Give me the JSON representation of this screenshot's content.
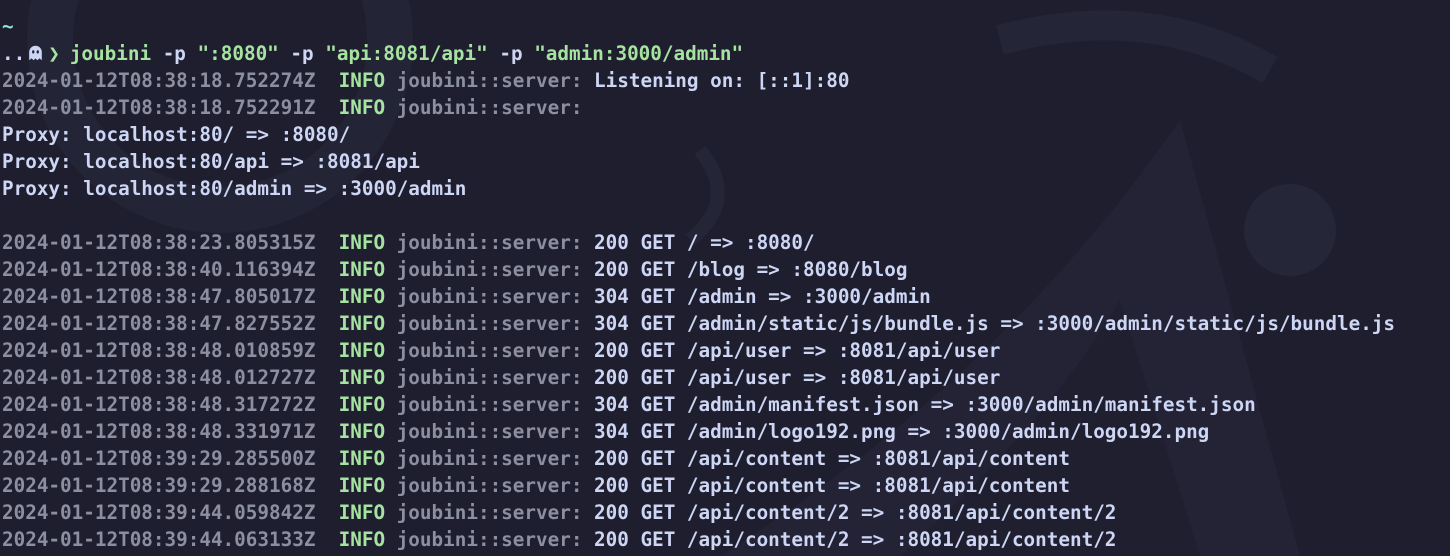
{
  "colors": {
    "background": "#1e1e2e",
    "foreground": "#cdd6f4",
    "green": "#a6e3a1",
    "teal": "#94e2d5",
    "dim": "#8c8fa1"
  },
  "prompt": {
    "cwd": "~",
    "dots": "..",
    "ghost_icon": "ghost-icon",
    "arrow": "❯",
    "command": "joubini",
    "args": [
      {
        "flag": "-p",
        "value": "\":8080\""
      },
      {
        "flag": "-p",
        "value": "\"api:8081/api\""
      },
      {
        "flag": "-p",
        "value": "\"admin:3000/admin\""
      }
    ]
  },
  "startup": [
    {
      "ts": "2024-01-12T08:38:18.752274Z",
      "level": "INFO",
      "target": "joubini::server:",
      "msg": "Listening on: [::1]:80"
    },
    {
      "ts": "2024-01-12T08:38:18.752291Z",
      "level": "INFO",
      "target": "joubini::server:",
      "msg": ""
    }
  ],
  "proxies": [
    "Proxy: localhost:80/ => :8080/",
    "Proxy: localhost:80/api => :8081/api",
    "Proxy: localhost:80/admin => :3000/admin"
  ],
  "requests": [
    {
      "ts": "2024-01-12T08:38:23.805315Z",
      "level": "INFO",
      "target": "joubini::server:",
      "msg": "200 GET / => :8080/"
    },
    {
      "ts": "2024-01-12T08:38:40.116394Z",
      "level": "INFO",
      "target": "joubini::server:",
      "msg": "200 GET /blog => :8080/blog"
    },
    {
      "ts": "2024-01-12T08:38:47.805017Z",
      "level": "INFO",
      "target": "joubini::server:",
      "msg": "304 GET /admin => :3000/admin"
    },
    {
      "ts": "2024-01-12T08:38:47.827552Z",
      "level": "INFO",
      "target": "joubini::server:",
      "msg": "304 GET /admin/static/js/bundle.js => :3000/admin/static/js/bundle.js"
    },
    {
      "ts": "2024-01-12T08:38:48.010859Z",
      "level": "INFO",
      "target": "joubini::server:",
      "msg": "200 GET /api/user => :8081/api/user"
    },
    {
      "ts": "2024-01-12T08:38:48.012727Z",
      "level": "INFO",
      "target": "joubini::server:",
      "msg": "200 GET /api/user => :8081/api/user"
    },
    {
      "ts": "2024-01-12T08:38:48.317272Z",
      "level": "INFO",
      "target": "joubini::server:",
      "msg": "304 GET /admin/manifest.json => :3000/admin/manifest.json"
    },
    {
      "ts": "2024-01-12T08:38:48.331971Z",
      "level": "INFO",
      "target": "joubini::server:",
      "msg": "304 GET /admin/logo192.png => :3000/admin/logo192.png"
    },
    {
      "ts": "2024-01-12T08:39:29.285500Z",
      "level": "INFO",
      "target": "joubini::server:",
      "msg": "200 GET /api/content => :8081/api/content"
    },
    {
      "ts": "2024-01-12T08:39:29.288168Z",
      "level": "INFO",
      "target": "joubini::server:",
      "msg": "200 GET /api/content => :8081/api/content"
    },
    {
      "ts": "2024-01-12T08:39:44.059842Z",
      "level": "INFO",
      "target": "joubini::server:",
      "msg": "200 GET /api/content/2 => :8081/api/content/2"
    },
    {
      "ts": "2024-01-12T08:39:44.063133Z",
      "level": "INFO",
      "target": "joubini::server:",
      "msg": "200 GET /api/content/2 => :8081/api/content/2"
    }
  ]
}
